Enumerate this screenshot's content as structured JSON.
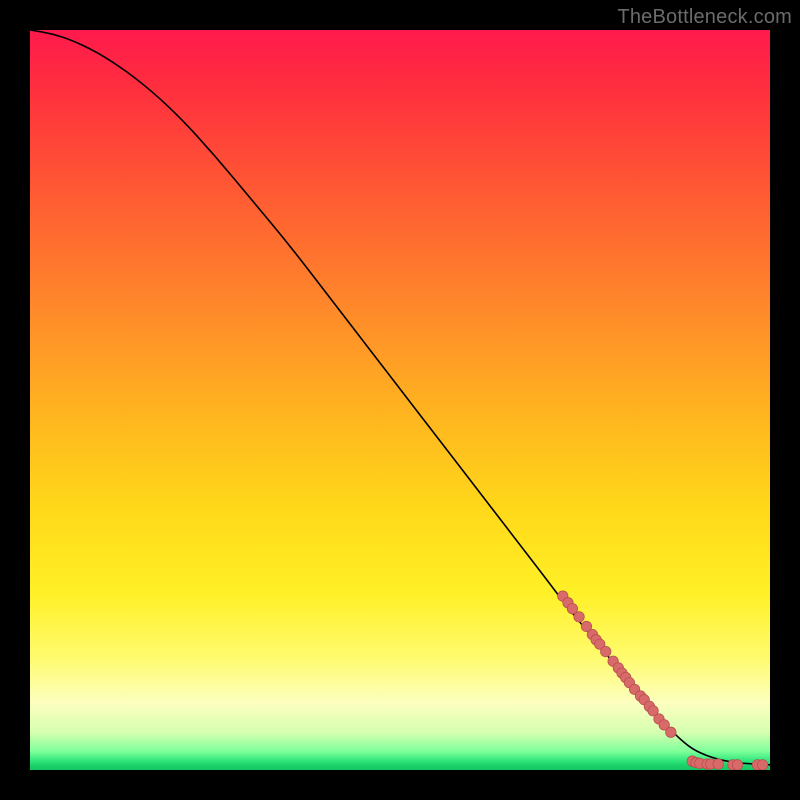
{
  "attribution": "TheBottleneck.com",
  "colors": {
    "background": "#000000",
    "curve": "#000000",
    "marker_fill": "#d86a6a",
    "marker_stroke": "#b94f4f",
    "gradient_stops": [
      "#ff1a4d",
      "#ff5a33",
      "#ffb51f",
      "#fff026",
      "#fcffc0",
      "#7dff9a",
      "#16c763"
    ]
  },
  "chart_data": {
    "type": "line",
    "title": "",
    "xlabel": "",
    "ylabel": "",
    "xlim": [
      0,
      100
    ],
    "ylim": [
      0,
      100
    ],
    "grid": false,
    "legend": false,
    "curve": {
      "x": [
        0,
        3,
        6,
        10,
        15,
        20,
        25,
        30,
        35,
        40,
        45,
        50,
        55,
        60,
        65,
        70,
        73,
        76,
        80,
        83,
        85,
        88,
        90,
        93,
        96,
        100
      ],
      "y": [
        100,
        99.5,
        98.5,
        96.5,
        93,
        88.5,
        83,
        77,
        71,
        64.5,
        58,
        51.5,
        45,
        38.5,
        32,
        25.5,
        21.5,
        18,
        13,
        9.5,
        7,
        4,
        2.5,
        1.4,
        0.9,
        0.7
      ]
    },
    "markers": [
      {
        "x": 72,
        "y": 23.5
      },
      {
        "x": 72.7,
        "y": 22.6
      },
      {
        "x": 73.3,
        "y": 21.8
      },
      {
        "x": 74.2,
        "y": 20.7
      },
      {
        "x": 75.2,
        "y": 19.4
      },
      {
        "x": 76,
        "y": 18.3
      },
      {
        "x": 76.5,
        "y": 17.6
      },
      {
        "x": 77,
        "y": 17.0
      },
      {
        "x": 77.8,
        "y": 16.0
      },
      {
        "x": 78.8,
        "y": 14.7
      },
      {
        "x": 79.5,
        "y": 13.8
      },
      {
        "x": 80.0,
        "y": 13.1
      },
      {
        "x": 80.5,
        "y": 12.5
      },
      {
        "x": 81.0,
        "y": 11.8
      },
      {
        "x": 81.7,
        "y": 10.9
      },
      {
        "x": 82.5,
        "y": 10.0
      },
      {
        "x": 83.0,
        "y": 9.5
      },
      {
        "x": 83.7,
        "y": 8.6
      },
      {
        "x": 84.2,
        "y": 8.0
      },
      {
        "x": 85.0,
        "y": 6.9
      },
      {
        "x": 85.7,
        "y": 6.1
      },
      {
        "x": 86.6,
        "y": 5.1
      },
      {
        "x": 89.5,
        "y": 1.2
      },
      {
        "x": 90.0,
        "y": 1.0
      },
      {
        "x": 90.5,
        "y": 0.9
      },
      {
        "x": 91.5,
        "y": 0.8
      },
      {
        "x": 92.0,
        "y": 0.8
      },
      {
        "x": 93.0,
        "y": 0.8
      },
      {
        "x": 95.0,
        "y": 0.7
      },
      {
        "x": 95.6,
        "y": 0.7
      },
      {
        "x": 98.3,
        "y": 0.7
      },
      {
        "x": 99.0,
        "y": 0.7
      }
    ]
  }
}
